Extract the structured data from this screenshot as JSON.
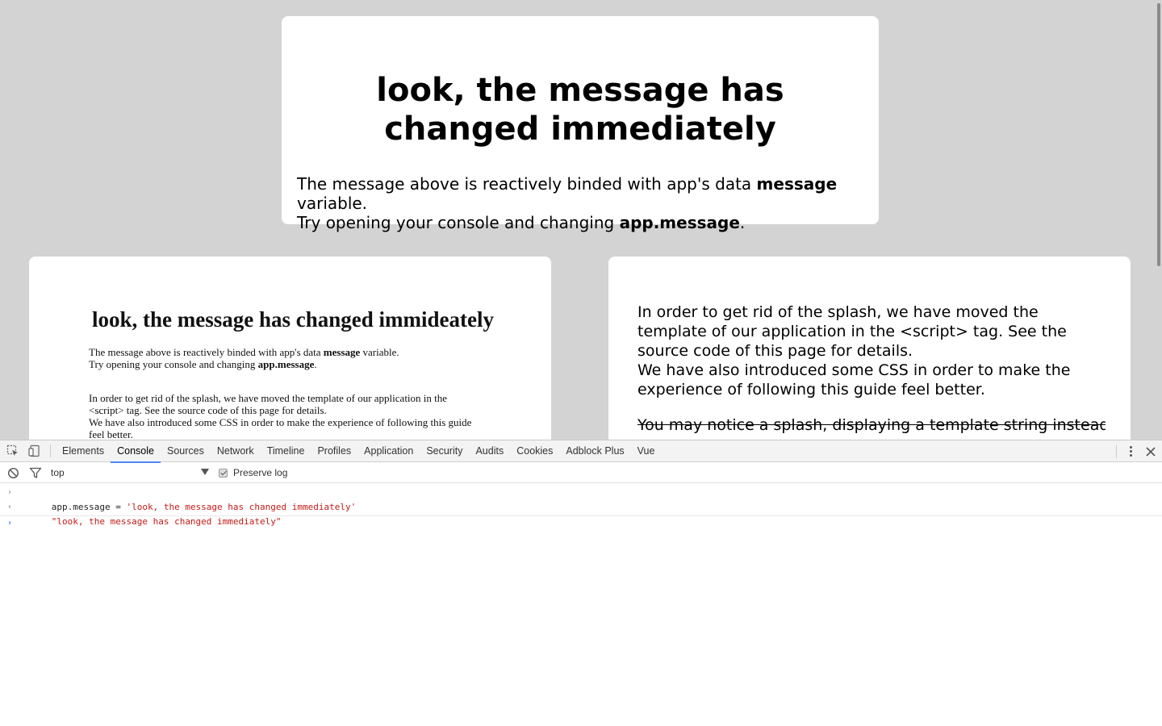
{
  "page": {
    "heading": "look, the message has changed immediately",
    "desc_line1_prefix": "The message above is reactively binded with app's data ",
    "desc_line1_bold": "message",
    "desc_line1_suffix": " variable.",
    "desc_line2_prefix": "Try opening your console and changing ",
    "desc_line2_bold": "app.message",
    "desc_line2_suffix": "."
  },
  "screenshot_card": {
    "heading": "look, the message has changed immideately",
    "p1_prefix": "The message above is reactively binded with app's data ",
    "p1_bold": "message",
    "p1_suffix": " variable.",
    "p2_prefix": "Try opening your console and changing ",
    "p2_bold": "app.message",
    "p2_suffix": ".",
    "p3_line1": "In order to get rid of the splash, we have moved the template of our application in the",
    "p3_line2": "<script> tag. See the source code of this page for details.",
    "p3_line3": "We have also introduced some CSS in order to make the experience of following this guide",
    "p3_line4": "feel better."
  },
  "explain_card": {
    "text1": "In order to get rid of the splash, we have moved the template of our application in the <script> tag. See the source code of this page for details.",
    "text2": "We have also introduced some CSS in order to make the experience of following this guide feel better.",
    "strike_text": "You may notice a splash, displaying a template string instead of"
  },
  "devtools": {
    "tabs": [
      "Elements",
      "Console",
      "Sources",
      "Network",
      "Timeline",
      "Profiles",
      "Application",
      "Security",
      "Audits",
      "Cookies",
      "Adblock Plus",
      "Vue"
    ],
    "active_tab": "Console",
    "context": "top",
    "preserve_log_label": "Preserve log",
    "preserve_log_checked": true,
    "console": {
      "input_code": "app.message = ",
      "input_string": "'look, the message has changed immediately'",
      "output": "\"look, the message has changed immediately\""
    }
  },
  "colors": {
    "page_bg": "#d3d3d3",
    "card_bg": "#ffffff",
    "active_tab_underline": "#4f86f7",
    "console_string": "#c41a16",
    "prompt_blue": "#367cf1"
  }
}
